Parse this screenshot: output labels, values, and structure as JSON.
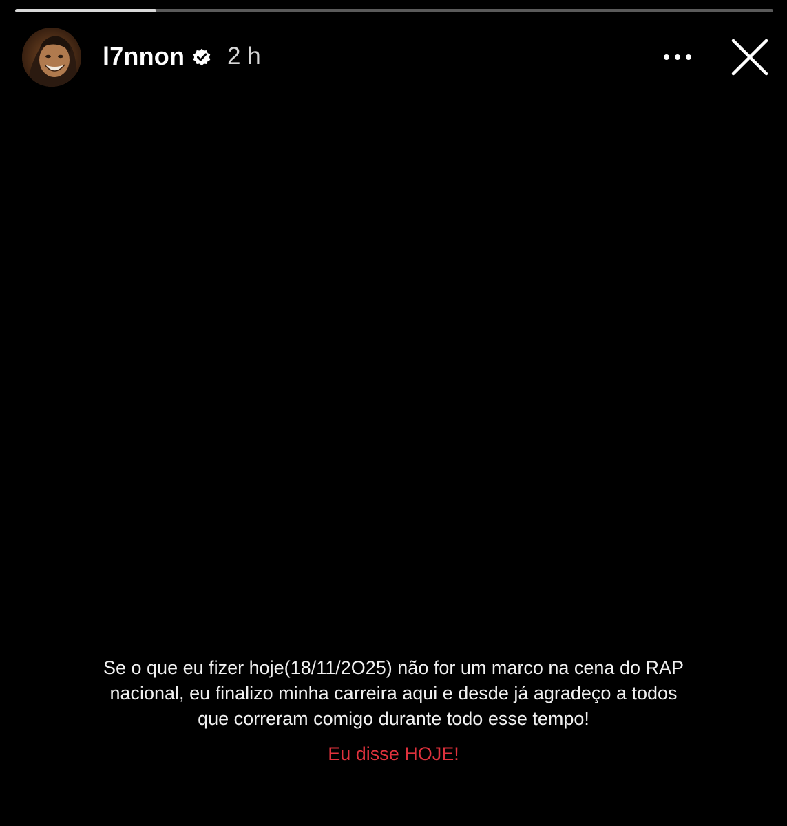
{
  "story": {
    "progress": 0.186,
    "progress_color": "#d8d8d8",
    "track_color": "#5a5a5a",
    "background_color": "#000000"
  },
  "header": {
    "username": "l7nnon",
    "verified_icon": "verified-badge-icon",
    "timestamp": "2 h",
    "more_icon": "more-options-icon",
    "close_icon": "close-icon"
  },
  "caption": {
    "lines": [
      "Se o que eu fizer hoje(18/11/2O25) não for um marco na cena do RAP",
      "nacional, eu finalizo minha carreira aqui e desde já agradeço a todos",
      "que correram comigo durante todo esse tempo!"
    ],
    "highlight": "Eu disse HOJE!",
    "highlight_color": "#e0323d",
    "text_color": "#f0f0f0"
  }
}
